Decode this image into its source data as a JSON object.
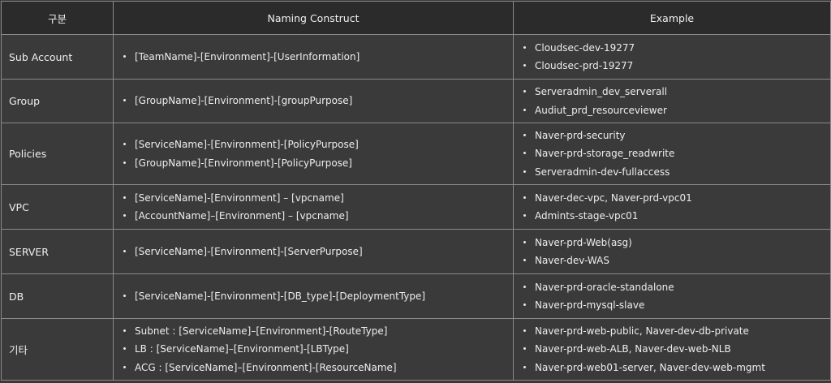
{
  "headers": {
    "category": "구분",
    "construct": "Naming Construct",
    "example": "Example"
  },
  "rows": [
    {
      "category": "Sub Account",
      "constructs": [
        "[TeamName]-[Environment]-[UserInformation]"
      ],
      "examples": [
        "Cloudsec-dev-19277",
        "Cloudsec-prd-19277"
      ]
    },
    {
      "category": "Group",
      "constructs": [
        "[GroupName]-[Environment]-[groupPurpose]"
      ],
      "examples": [
        "Serveradmin_dev_serverall",
        "Audiut_prd_resourceviewer"
      ]
    },
    {
      "category": "Policies",
      "constructs": [
        "[ServiceName]-[Environment]-[PolicyPurpose]",
        "[GroupName]-[Environment]-[PolicyPurpose]"
      ],
      "examples": [
        "Naver-prd-security",
        "Naver-prd-storage_readwrite",
        "Serveradmin-dev-fullaccess"
      ]
    },
    {
      "category": "VPC",
      "constructs": [
        "[ServiceName]-[Environment] – [vpcname]",
        "[AccountName]–[Environment] – [vpcname]"
      ],
      "examples": [
        "Naver-dec-vpc, Naver-prd-vpc01",
        "Admints-stage-vpc01"
      ]
    },
    {
      "category": "SERVER",
      "constructs": [
        "[ServiceName]-[Environment]-[ServerPurpose]"
      ],
      "examples": [
        "Naver-prd-Web(asg)",
        "Naver-dev-WAS"
      ]
    },
    {
      "category": "DB",
      "constructs": [
        "[ServiceName]-[Environment]-[DB_type]-[DeploymentType]"
      ],
      "examples": [
        "Naver-prd-oracle-standalone",
        "Naver-prd-mysql-slave"
      ]
    },
    {
      "category": "기타",
      "constructs": [
        "Subnet : [ServiceName]–[Environment]-[RouteType]",
        "LB : [ServiceName]–[Environment]-[LBType]",
        "ACG : [ServiceName]–[Environment]-[ResourceName]"
      ],
      "examples": [
        "Naver-prd-web-public, Naver-dev-db-private",
        "Naver-prd-web-ALB, Naver-dev-web-NLB",
        "Naver-prd-web01-server, Naver-dev-web-mgmt"
      ]
    }
  ]
}
